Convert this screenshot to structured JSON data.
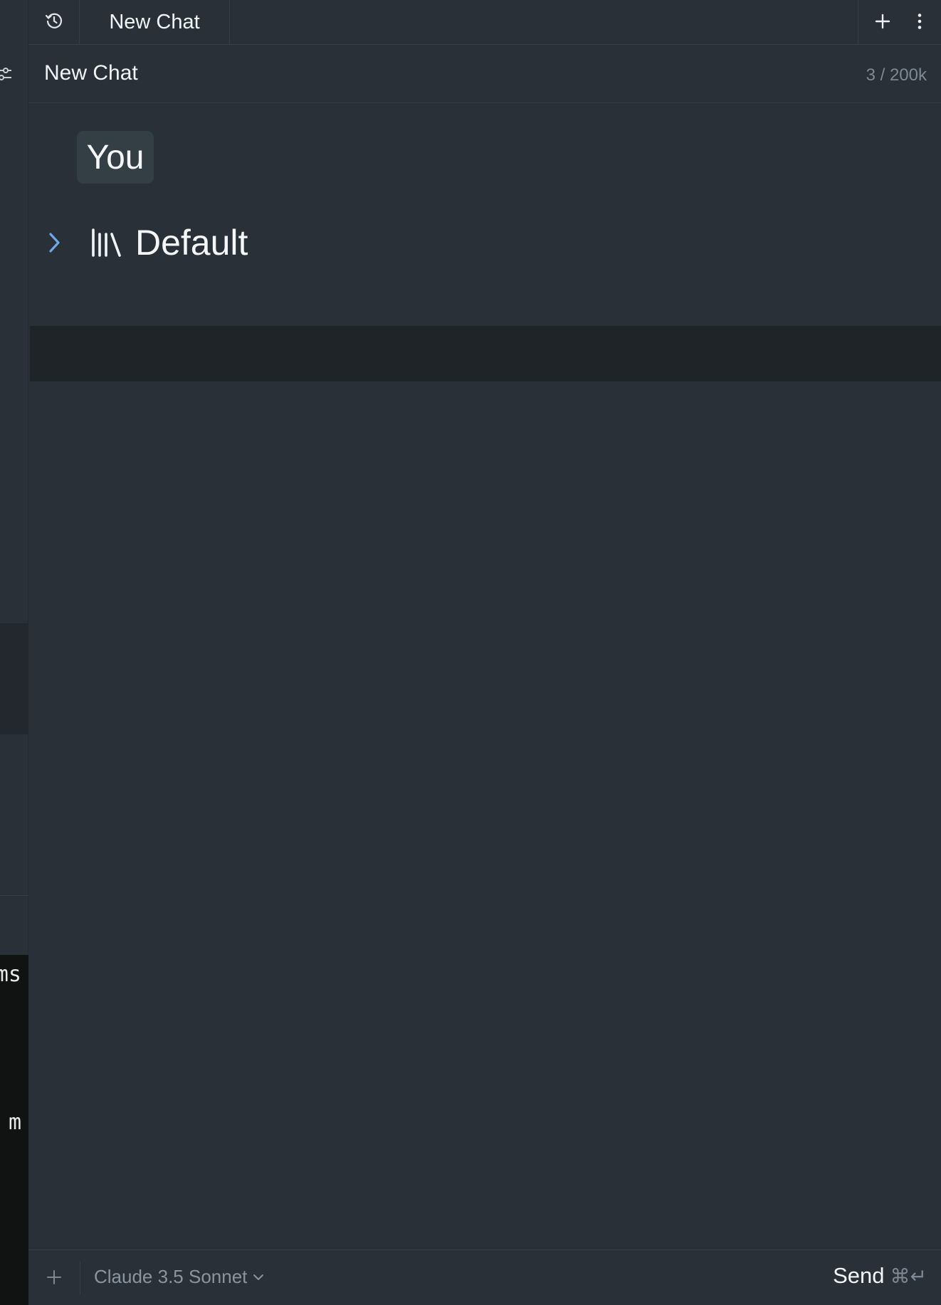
{
  "tab": {
    "title": "New Chat"
  },
  "chat": {
    "title": "New Chat",
    "token_count": "3 / 200k"
  },
  "messages": [
    {
      "role": "You"
    },
    {
      "label": "Default"
    }
  ],
  "left_panel": {
    "terminal_fragment_1": "ms",
    "terminal_fragment_2": "m"
  },
  "footer": {
    "model": "Claude 3.5 Sonnet",
    "send_label": "Send",
    "send_shortcut": "⌘↵"
  },
  "icons": {
    "history": "history-icon",
    "plus": "plus-icon",
    "more": "more-vertical-icon",
    "filter": "sliders-icon",
    "chevron": "chevron-right-icon",
    "library": "library-icon",
    "caret": "chevron-down-icon"
  },
  "colors": {
    "background": "#293038",
    "accent": "#6fa8e6",
    "muted": "#7d8892"
  }
}
